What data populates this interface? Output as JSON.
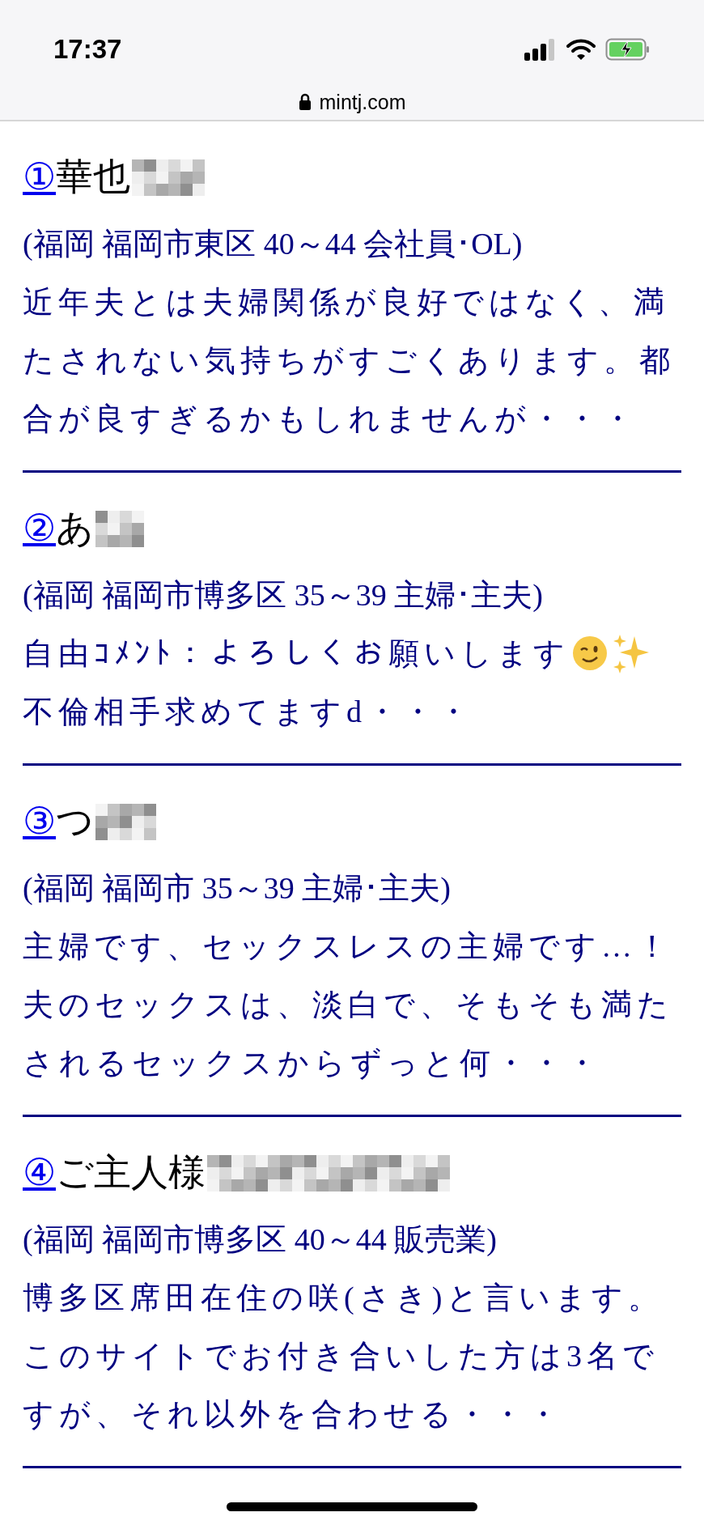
{
  "status_bar": {
    "time": "17:37"
  },
  "address_bar": {
    "url": "mintj.com"
  },
  "entries": [
    {
      "number": "①",
      "name": "華也",
      "meta": "(福岡 福岡市東区 40～44 会社員･OL)",
      "lines": [
        "近年夫とは夫婦関係が良好ではなく、満",
        "たされない気持ちがすごくあります。都",
        "合が良すぎるかもしれませんが・・・"
      ],
      "emoji": false
    },
    {
      "number": "②",
      "name": "あ",
      "meta": "(福岡 福岡市博多区 35～39 主婦･主夫)",
      "lines": [
        "自由ｺﾒﾝﾄ：よろしくお願いします",
        "不倫相手求めてますd・・・"
      ],
      "emoji": true
    },
    {
      "number": "③",
      "name": "つ",
      "meta": "(福岡 福岡市 35～39 主婦･主夫)",
      "lines": [
        "主婦です、セックスレスの主婦です…！",
        "夫のセックスは、淡白で、そもそも満た",
        "されるセックスからずっと何・・・"
      ],
      "emoji": false
    },
    {
      "number": "④",
      "name": "ご主人様",
      "meta": "(福岡 福岡市博多区 40～44 販売業)",
      "lines": [
        "博多区席田在住の咲(さき)と言います。",
        "このサイトでお付き合いした方は3名で",
        "すが、それ以外を合わせる・・・"
      ],
      "emoji": false
    }
  ]
}
